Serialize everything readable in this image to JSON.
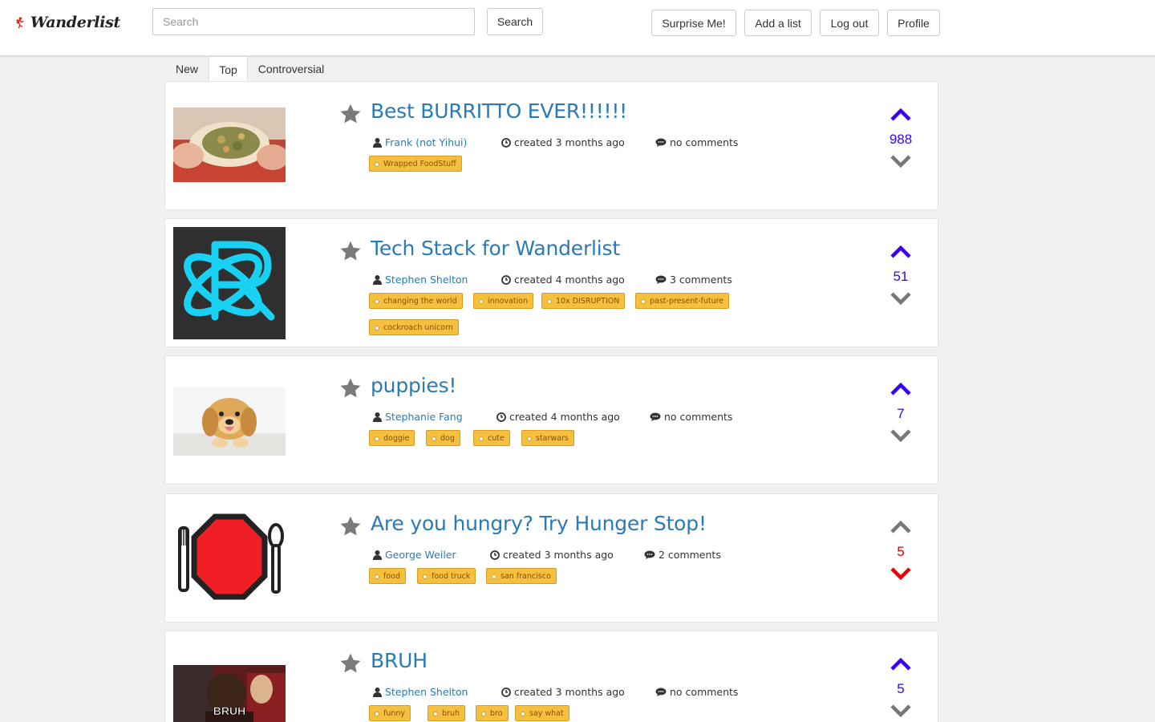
{
  "header": {
    "logo_text": "Wanderlist",
    "search_placeholder": "Search",
    "search_button": "Search",
    "surprise_button": "Surprise Me!",
    "add_list_button": "Add a list",
    "logout_button": "Log out",
    "profile_button": "Profile"
  },
  "tabs": [
    {
      "label": "New"
    },
    {
      "label": "Top",
      "active": true
    },
    {
      "label": "Controversial"
    }
  ],
  "colors": {
    "link_blue": "#2a7ab8",
    "vote_blue": "#3a00f5",
    "vote_red": "#e8000b",
    "vote_gray": "#777777",
    "tag_fill": "#f5c040"
  },
  "lists": [
    {
      "title": "Best BURRITTO EVER!!!!!!",
      "author": "Frank (not Yihui)",
      "created": "created 3 months ago",
      "comments": "no comments",
      "tags": [
        "Wrapped FoodStuff"
      ],
      "votes": "988",
      "vote_state": "up",
      "thumbnail": "burrito-photo"
    },
    {
      "title": "Tech Stack for Wanderlist",
      "author": "Stephen Shelton",
      "created": "created 4 months ago",
      "comments": "3 comments",
      "tags": [
        "changing the world",
        "innovation",
        "10x DISRUPTION",
        "past-present-future",
        "cockroach unicorn"
      ],
      "votes": "51",
      "vote_state": "up",
      "thumbnail": "redux-logo"
    },
    {
      "title": "puppies!",
      "author": "Stephanie Fang",
      "created": "created 4 months ago",
      "comments": "no comments",
      "tags": [
        "doggie",
        "dog",
        "cute",
        "starwars"
      ],
      "votes": "7",
      "vote_state": "up",
      "thumbnail": "puppy-photo"
    },
    {
      "title": "Are you hungry? Try Hunger Stop!",
      "author": "George Weiler",
      "created": "created 3 months ago",
      "comments": "2 comments",
      "tags": [
        "food",
        "food truck",
        "san francisco"
      ],
      "votes": "5",
      "vote_state": "down",
      "thumbnail": "hunger-stop-logo"
    },
    {
      "title": "BRUH",
      "author": "Stephen Shelton",
      "created": "created 3 months ago",
      "comments": "no comments",
      "tags": [
        "funny",
        "bruh",
        "bro",
        "say what"
      ],
      "votes": "5",
      "vote_state": "up",
      "thumbnail": "bruh-meme",
      "thumbnail_caption": "BRUH"
    }
  ]
}
